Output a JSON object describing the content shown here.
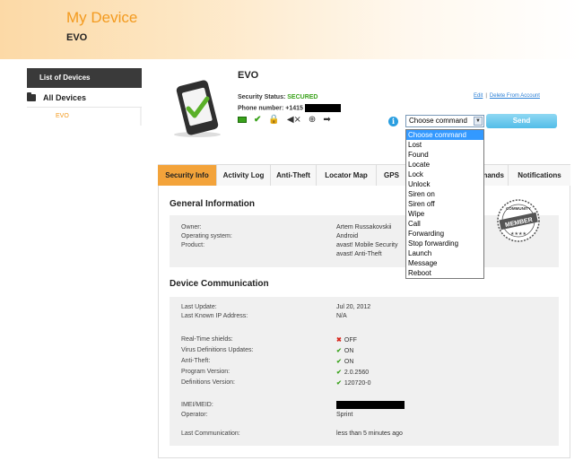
{
  "header": {
    "title": "My Device",
    "subtitle": "EVO"
  },
  "sidebar": {
    "heading": "List of Devices",
    "all_devices": "All Devices",
    "device": "EVO"
  },
  "device": {
    "name": "EVO",
    "status_label": "Security Status:",
    "status_value": "SECURED",
    "phone_label": "Phone number: +1415",
    "links": {
      "edit": "Edit",
      "delete": "Delete From Account"
    }
  },
  "command": {
    "selected": "Choose command",
    "send_label": "Send",
    "options": [
      "Choose command",
      "Lost",
      "Found",
      "Locate",
      "Lock",
      "Unlock",
      "Siren on",
      "Siren off",
      "Wipe",
      "Call",
      "Forwarding",
      "Stop forwarding",
      "Launch",
      "Message",
      "Reboot"
    ]
  },
  "tabs": [
    "Security Info",
    "Activity Log",
    "Anti-Theft",
    "Locator Map",
    "GPS",
    "nands",
    "Notifications"
  ],
  "general": {
    "title": "General Information",
    "owner_label": "Owner:",
    "owner": "Artem Russakovskii",
    "os_label": "Operating system:",
    "os": "Android",
    "product_label": "Product:",
    "product1": "avast! Mobile Security",
    "product2": "avast! Anti-Theft"
  },
  "comm": {
    "title": "Device Communication",
    "last_update_label": "Last Update:",
    "last_update": "Jul 20, 2012",
    "ip_label": "Last Known IP Address:",
    "ip": "N/A",
    "rts_label": "Real-Time shields:",
    "rts": "OFF",
    "vdu_label": "Virus Definitions Updates:",
    "vdu": "ON",
    "at_label": "Anti-Theft:",
    "at": "ON",
    "pv_label": "Program Version:",
    "pv": "2.0.2560",
    "dv_label": "Definitions Version:",
    "dv": "120720-0",
    "imei_label": "IMEI/MEID:",
    "operator_label": "Operator:",
    "operator": "Sprint",
    "lc_label": "Last Communication:",
    "lc": "less than 5 minutes ago"
  },
  "badge": {
    "top": "COMMUNITY",
    "main": "MEMBER"
  },
  "colors": {
    "accent": "#f39a1e",
    "ok": "#3aa21b",
    "error": "#d8261b",
    "link": "#2a7fd6",
    "highlight": "#3399ff"
  }
}
